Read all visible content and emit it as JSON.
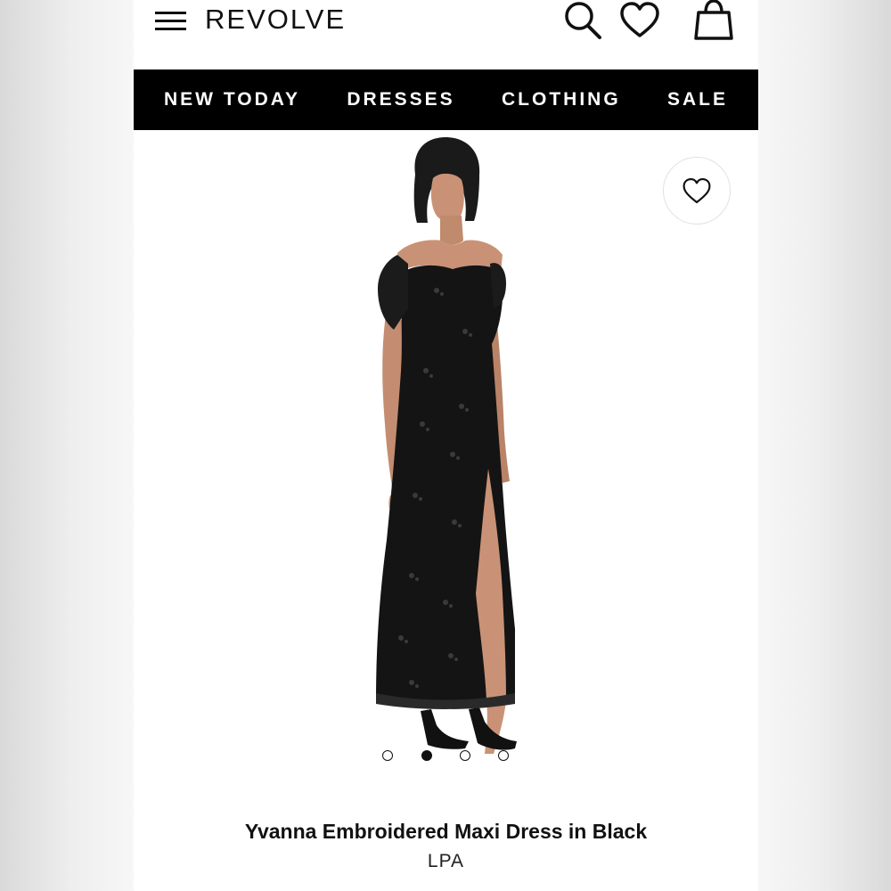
{
  "header": {
    "logo": "REVOLVE",
    "icons": [
      "menu-icon",
      "search-icon",
      "heart-icon",
      "shopping-bag-icon"
    ]
  },
  "nav": {
    "items": [
      {
        "label": "NEW TODAY"
      },
      {
        "label": "DRESSES"
      },
      {
        "label": "CLOTHING"
      },
      {
        "label": "SALE"
      }
    ]
  },
  "product": {
    "image_icon": "product-photo",
    "favorite_icon": "heart-outline-icon",
    "carousel": {
      "total": 4,
      "active_index": 1
    },
    "title": "Yvanna Embroidered Maxi Dress in Black",
    "brand": "LPA"
  },
  "colors": {
    "nav_background": "#000000",
    "nav_text": "#ffffff",
    "text": "#111111",
    "dress": "#141414"
  }
}
